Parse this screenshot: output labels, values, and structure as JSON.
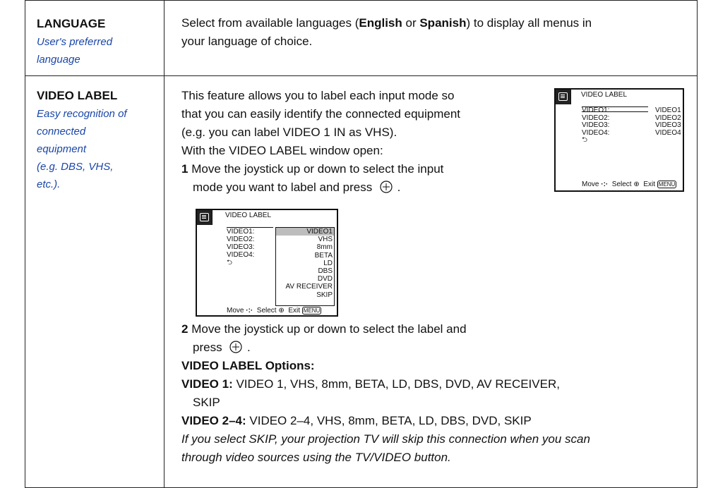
{
  "language": {
    "term": "LANGUAGE",
    "desc_lines": [
      "User's preferred",
      "language"
    ],
    "text_pre": "Select from available languages (",
    "opt1": "English",
    "text_mid": " or ",
    "opt2": "Spanish",
    "text_post": ") to display all menus in",
    "line2": "your language of choice."
  },
  "video_label": {
    "term": "VIDEO LABEL",
    "desc_lines": [
      "Easy recognition of",
      "connected",
      "equipment",
      "(e.g. DBS, VHS,",
      "etc.)."
    ],
    "intro_lines": [
      "This feature allows you to label each input mode so",
      "that you can easily identify the connected equipment",
      "(e.g. you can label VIDEO 1 IN as VHS).",
      "With the VIDEO LABEL window open:"
    ],
    "step1_num": "1",
    "step1_line1": "Move the joystick up or down to select the input",
    "step1_line2": "mode you want to label and press",
    "step2_num": "2",
    "step2_line1": "Move the joystick up or down to select the label and",
    "step2_line2": "press",
    "options_heading": "VIDEO LABEL Options:",
    "opt1_label": "VIDEO 1:",
    "opt1_text": " VIDEO 1, VHS, 8mm, BETA, LD, DBS, DVD, AV RECEIVER,",
    "opt1_cont": "SKIP",
    "opt2_label": "VIDEO 2–4:",
    "opt2_text": " VIDEO 2–4, VHS, 8mm, BETA, LD, DBS, DVD, SKIP",
    "note_lines": [
      "If you select SKIP, your projection TV will skip this connection when you scan",
      "through video sources using the TV/VIDEO button."
    ]
  },
  "osd1": {
    "title": "VIDEO LABEL",
    "inputs": [
      "VIDEO1:",
      "VIDEO2:",
      "VIDEO3:",
      "VIDEO4:"
    ],
    "values": [
      "VIDEO1",
      "VIDEO2",
      "VIDEO3",
      "VIDEO4"
    ],
    "return_symbol": "⮌",
    "footer_move": "Move",
    "footer_select": "Select",
    "footer_exit": "Exit",
    "footer_menu": "MENU"
  },
  "osd2": {
    "title": "VIDEO LABEL",
    "inputs": [
      "VIDEO1:",
      "VIDEO2:",
      "VIDEO3:",
      "VIDEO4:"
    ],
    "options": [
      "VIDEO1",
      "VHS",
      "8mm",
      "BETA",
      "LD",
      "DBS",
      "DVD",
      "AV RECEIVER",
      "SKIP"
    ],
    "selected_option": "VIDEO1",
    "return_symbol": "⮌",
    "footer_move": "Move",
    "footer_select": "Select",
    "footer_exit": "Exit",
    "footer_menu": "MENU"
  }
}
